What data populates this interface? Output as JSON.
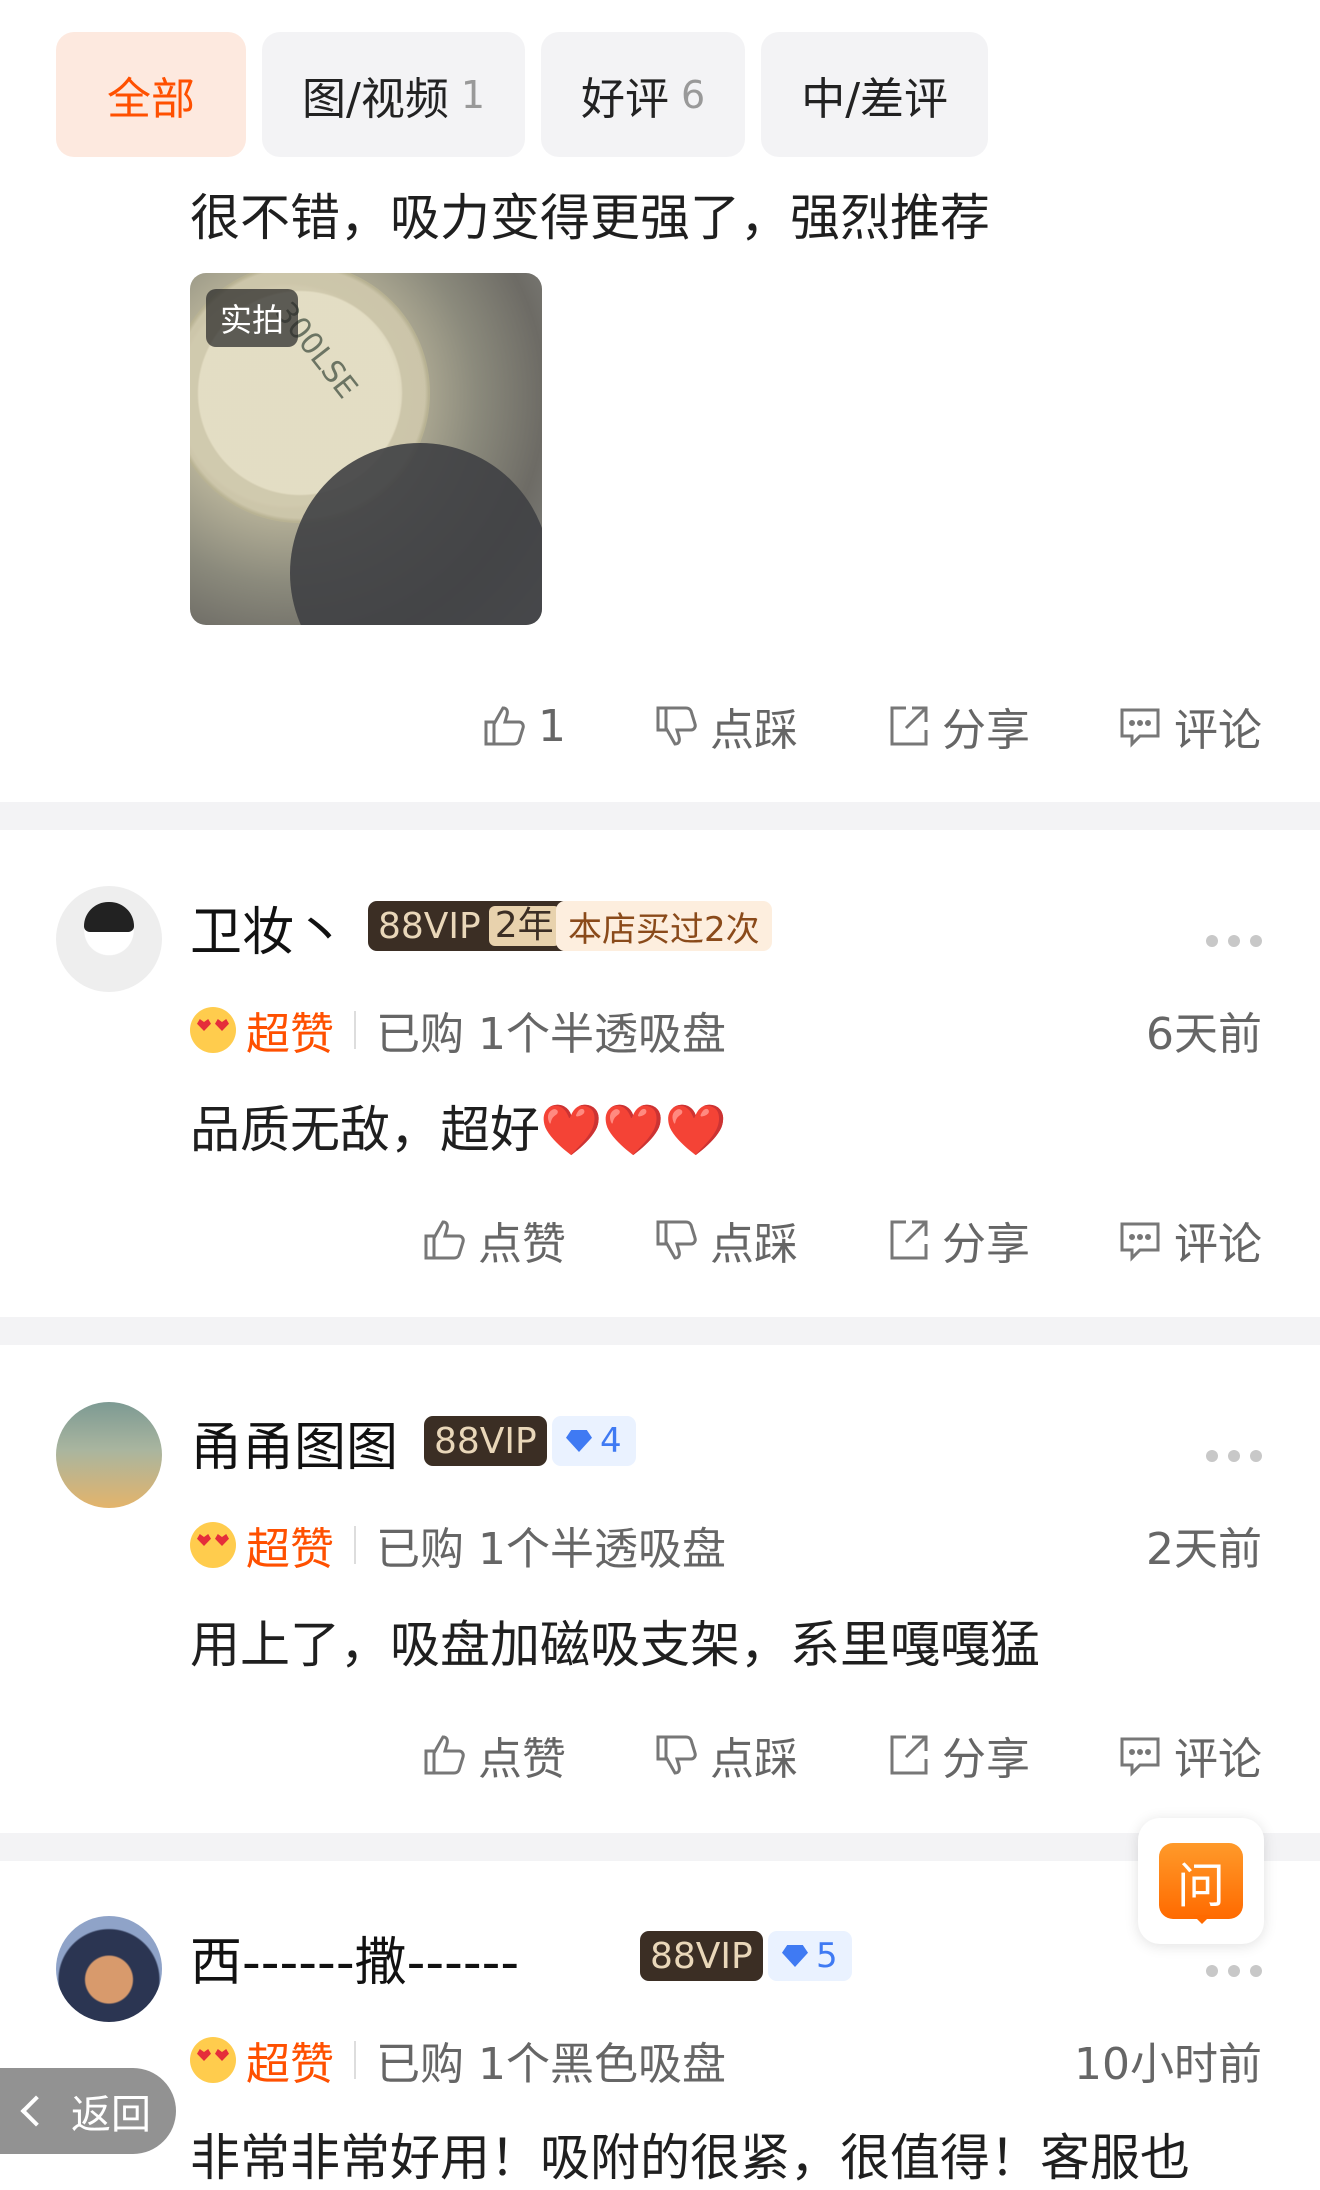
{
  "tabs": [
    {
      "label": "全部",
      "count": ""
    },
    {
      "label": "图/视频",
      "count": "1"
    },
    {
      "label": "好评",
      "count": "6"
    },
    {
      "label": "中/差评",
      "count": ""
    }
  ],
  "review0": {
    "text": "很不错，吸力变得更强了，强烈推荐",
    "photo_tag": "实拍",
    "photo_print": "300LSE",
    "like": "1",
    "dislike": "点踩",
    "share": "分享",
    "comment": "评论"
  },
  "review1": {
    "name": "卫妆丶",
    "vip": "88VIP",
    "vip_years": "2年",
    "buy_tag": "本店买过2次",
    "praise": "超赞",
    "bought": "已购 1个半透吸盘",
    "time": "6天前",
    "text": "品质无敌，超好",
    "hearts": "❤️❤️❤️",
    "like": "点赞",
    "dislike": "点踩",
    "share": "分享",
    "comment": "评论"
  },
  "review2": {
    "name": "甬甬图图",
    "vip": "88VIP",
    "level": "4",
    "praise": "超赞",
    "bought": "已购 1个半透吸盘",
    "time": "2天前",
    "text": "用上了，吸盘加磁吸支架，系里嘎嘎猛",
    "like": "点赞",
    "dislike": "点踩",
    "share": "分享",
    "comment": "评论"
  },
  "review3": {
    "name": "西------撒------",
    "vip": "88VIP",
    "level": "5",
    "praise": "超赞",
    "bought": "已购 1个黑色吸盘",
    "time": "10小时前",
    "text": "非常非常好用！吸附的很紧，很值得！客服也"
  },
  "ask_label": "问",
  "back_label": "返回",
  "colors": {
    "accent": "#ff5000",
    "vip_bg": "#3b2e24",
    "gem": "#3f7af3"
  }
}
